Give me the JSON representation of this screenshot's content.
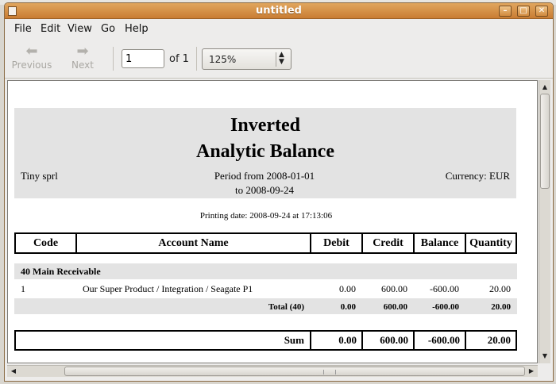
{
  "window": {
    "title": "untitled"
  },
  "menu": {
    "file": "File",
    "edit": "Edit",
    "view": "View",
    "go": "Go",
    "help": "Help"
  },
  "toolbar": {
    "previous_label": "Previous",
    "next_label": "Next",
    "page_value": "1",
    "page_of": "of 1",
    "zoom_value": "125%"
  },
  "report": {
    "title_line1": "Inverted",
    "title_line2": "Analytic Balance",
    "company": "Tiny sprl",
    "period_line1": "Period from 2008-01-01",
    "period_line2": "to 2008-09-24",
    "currency": "Currency: EUR",
    "printing_date": "Printing date: 2008-09-24 at 17:13:06",
    "columns": [
      "Code",
      "Account Name",
      "Debit",
      "Credit",
      "Balance",
      "Quantity"
    ],
    "group": {
      "label": "40 Main Receivable"
    },
    "row": {
      "code": "1",
      "account": "Our Super Product / Integration / Seagate P1",
      "debit": "0.00",
      "credit": "600.00",
      "balance": "-600.00",
      "quantity": "20.00"
    },
    "total": {
      "label": "Total (40)",
      "debit": "0.00",
      "credit": "600.00",
      "balance": "-600.00",
      "quantity": "20.00"
    },
    "sum": {
      "label": "Sum",
      "debit": "0.00",
      "credit": "600.00",
      "balance": "-600.00",
      "quantity": "20.00"
    }
  }
}
